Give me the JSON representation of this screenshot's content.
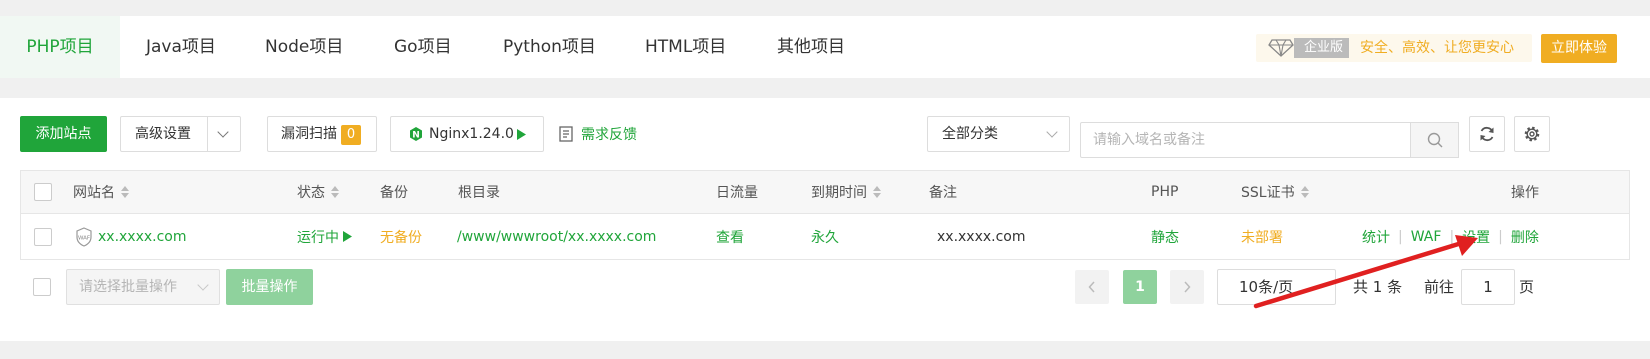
{
  "tabs": [
    {
      "label": "PHP项目",
      "active": true
    },
    {
      "label": "Java项目",
      "active": false
    },
    {
      "label": "Node项目",
      "active": false
    },
    {
      "label": "Go项目",
      "active": false
    },
    {
      "label": "Python项目",
      "active": false
    },
    {
      "label": "HTML项目",
      "active": false
    },
    {
      "label": "其他项目",
      "active": false
    }
  ],
  "promo": {
    "icon": "diamond-icon",
    "badge": "企业版",
    "text": "安全、高效、让您更安心",
    "button": "立即体验"
  },
  "toolbar": {
    "add_site": "添加站点",
    "advanced": "高级设置",
    "vuln_scan": "漏洞扫描",
    "vuln_count": "0",
    "nginx": "Nginx1.24.0",
    "feedback": "需求反馈",
    "category": "全部分类",
    "search_placeholder": "请输入域名或备注"
  },
  "table": {
    "headers": {
      "name": "网站名",
      "status": "状态",
      "backup": "备份",
      "root": "根目录",
      "traffic": "日流量",
      "expire": "到期时间",
      "remark": "备注",
      "php": "PHP",
      "ssl": "SSL证书",
      "actions": "操作"
    },
    "rows": [
      {
        "name": "xx.xxxx.com",
        "waf_icon": "WAF",
        "status": "运行中",
        "backup": "无备份",
        "root": "/www/wwwroot/xx.xxxx.com",
        "traffic": "查看",
        "expire": "永久",
        "remark": "xx.xxxx.com",
        "php": "静态",
        "ssl": "未部署",
        "actions": [
          "统计",
          "WAF",
          "设置",
          "删除"
        ]
      }
    ]
  },
  "footer": {
    "batch_placeholder": "请选择批量操作",
    "batch_button": "批量操作",
    "current_page": "1",
    "per_page": "10条/页",
    "total": "共 1 条",
    "goto_prefix": "前往",
    "goto_value": "1",
    "goto_suffix": "页"
  },
  "colors": {
    "primary": "#20a53a",
    "warning": "#f0ad22",
    "arrow": "#e02020"
  }
}
